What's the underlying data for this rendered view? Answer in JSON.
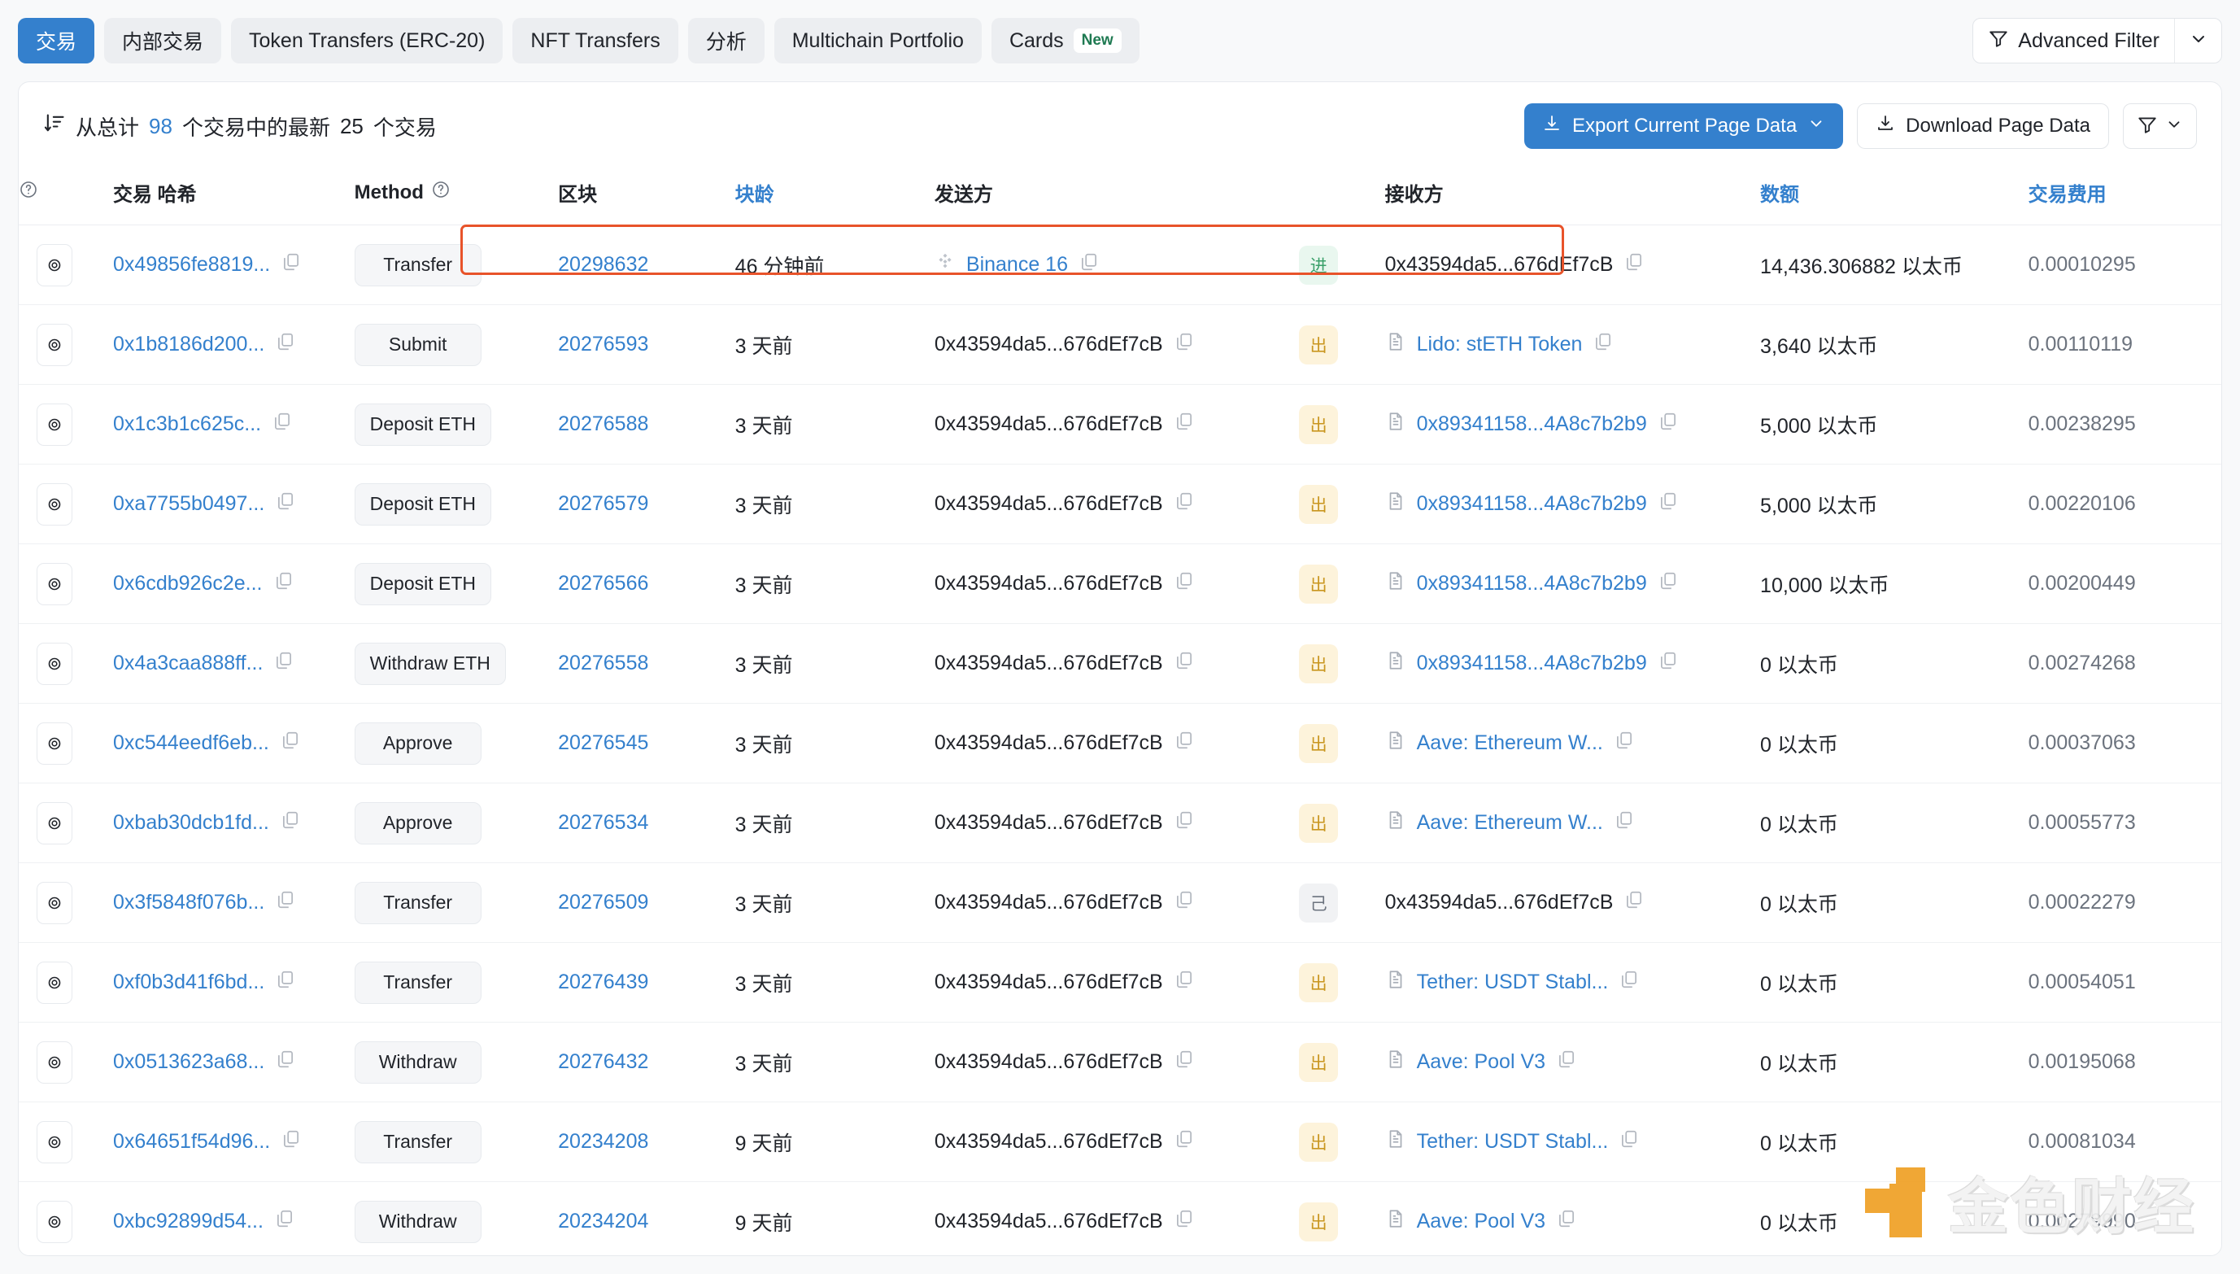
{
  "topbar": {
    "tabs": [
      {
        "label": "交易",
        "active": true
      },
      {
        "label": "内部交易",
        "active": false
      },
      {
        "label": "Token Transfers (ERC-20)",
        "active": false
      },
      {
        "label": "NFT Transfers",
        "active": false
      },
      {
        "label": "分析",
        "active": false
      },
      {
        "label": "Multichain Portfolio",
        "active": false
      },
      {
        "label": "Cards",
        "active": false,
        "badge": "New"
      }
    ],
    "advanced_filter_label": "Advanced Filter"
  },
  "card_head": {
    "summary_prefix": "从总计",
    "total_count": "98",
    "summary_middle": "个交易中的最新",
    "page_count": "25",
    "summary_suffix": "个交易",
    "export_label": "Export Current Page Data",
    "download_label": "Download Page Data"
  },
  "table": {
    "columns": [
      {
        "key": "eye",
        "label": "",
        "link": false
      },
      {
        "key": "hash",
        "label": "交易 哈希",
        "link": false
      },
      {
        "key": "method",
        "label": "Method",
        "link": false
      },
      {
        "key": "block",
        "label": "区块",
        "link": false
      },
      {
        "key": "age",
        "label": "块龄",
        "link": true
      },
      {
        "key": "from",
        "label": "发送方",
        "link": false
      },
      {
        "key": "dir",
        "label": "",
        "link": false
      },
      {
        "key": "to",
        "label": "接收方",
        "link": false
      },
      {
        "key": "amount",
        "label": "数额",
        "link": true
      },
      {
        "key": "fee",
        "label": "交易费用",
        "link": true
      }
    ],
    "rows": [
      {
        "hash": "0x49856fe8819...",
        "method": "Transfer",
        "block": "20298632",
        "age": "46 分钟前",
        "from": "Binance 16",
        "from_link": true,
        "from_icon": "binance-icon",
        "dir": "进",
        "dir_type": "in",
        "to": "0x43594da5...676dEf7cB",
        "to_link": false,
        "to_contract": false,
        "amount": "14,436.306882 以太币",
        "fee": "0.00010295",
        "highlight": true
      },
      {
        "hash": "0x1b8186d200...",
        "method": "Submit",
        "block": "20276593",
        "age": "3 天前",
        "from": "0x43594da5...676dEf7cB",
        "from_link": false,
        "from_icon": "",
        "dir": "出",
        "dir_type": "out",
        "to": "Lido: stETH Token",
        "to_link": true,
        "to_contract": true,
        "amount": "3,640 以太币",
        "fee": "0.00110119",
        "highlight": false
      },
      {
        "hash": "0x1c3b1c625c...",
        "method": "Deposit ETH",
        "block": "20276588",
        "age": "3 天前",
        "from": "0x43594da5...676dEf7cB",
        "from_link": false,
        "from_icon": "",
        "dir": "出",
        "dir_type": "out",
        "to": "0x89341158...4A8c7b2b9",
        "to_link": true,
        "to_contract": true,
        "amount": "5,000 以太币",
        "fee": "0.00238295",
        "highlight": false
      },
      {
        "hash": "0xa7755b0497...",
        "method": "Deposit ETH",
        "block": "20276579",
        "age": "3 天前",
        "from": "0x43594da5...676dEf7cB",
        "from_link": false,
        "from_icon": "",
        "dir": "出",
        "dir_type": "out",
        "to": "0x89341158...4A8c7b2b9",
        "to_link": true,
        "to_contract": true,
        "amount": "5,000 以太币",
        "fee": "0.00220106",
        "highlight": false
      },
      {
        "hash": "0x6cdb926c2e...",
        "method": "Deposit ETH",
        "block": "20276566",
        "age": "3 天前",
        "from": "0x43594da5...676dEf7cB",
        "from_link": false,
        "from_icon": "",
        "dir": "出",
        "dir_type": "out",
        "to": "0x89341158...4A8c7b2b9",
        "to_link": true,
        "to_contract": true,
        "amount": "10,000 以太币",
        "fee": "0.00200449",
        "highlight": false
      },
      {
        "hash": "0x4a3caa888ff...",
        "method": "Withdraw ETH",
        "block": "20276558",
        "age": "3 天前",
        "from": "0x43594da5...676dEf7cB",
        "from_link": false,
        "from_icon": "",
        "dir": "出",
        "dir_type": "out",
        "to": "0x89341158...4A8c7b2b9",
        "to_link": true,
        "to_contract": true,
        "amount": "0 以太币",
        "fee": "0.00274268",
        "highlight": false
      },
      {
        "hash": "0xc544eedf6eb...",
        "method": "Approve",
        "block": "20276545",
        "age": "3 天前",
        "from": "0x43594da5...676dEf7cB",
        "from_link": false,
        "from_icon": "",
        "dir": "出",
        "dir_type": "out",
        "to": "Aave: Ethereum W...",
        "to_link": true,
        "to_contract": true,
        "amount": "0 以太币",
        "fee": "0.00037063",
        "highlight": false
      },
      {
        "hash": "0xbab30dcb1fd...",
        "method": "Approve",
        "block": "20276534",
        "age": "3 天前",
        "from": "0x43594da5...676dEf7cB",
        "from_link": false,
        "from_icon": "",
        "dir": "出",
        "dir_type": "out",
        "to": "Aave: Ethereum W...",
        "to_link": true,
        "to_contract": true,
        "amount": "0 以太币",
        "fee": "0.00055773",
        "highlight": false
      },
      {
        "hash": "0x3f5848f076b...",
        "method": "Transfer",
        "block": "20276509",
        "age": "3 天前",
        "from": "0x43594da5...676dEf7cB",
        "from_link": false,
        "from_icon": "",
        "dir": "己",
        "dir_type": "self",
        "to": "0x43594da5...676dEf7cB",
        "to_link": false,
        "to_contract": false,
        "amount": "0 以太币",
        "fee": "0.00022279",
        "highlight": false
      },
      {
        "hash": "0xf0b3d41f6bd...",
        "method": "Transfer",
        "block": "20276439",
        "age": "3 天前",
        "from": "0x43594da5...676dEf7cB",
        "from_link": false,
        "from_icon": "",
        "dir": "出",
        "dir_type": "out",
        "to": "Tether: USDT Stabl...",
        "to_link": true,
        "to_contract": true,
        "amount": "0 以太币",
        "fee": "0.00054051",
        "highlight": false
      },
      {
        "hash": "0x0513623a68...",
        "method": "Withdraw",
        "block": "20276432",
        "age": "3 天前",
        "from": "0x43594da5...676dEf7cB",
        "from_link": false,
        "from_icon": "",
        "dir": "出",
        "dir_type": "out",
        "to": "Aave: Pool V3",
        "to_link": true,
        "to_contract": true,
        "amount": "0 以太币",
        "fee": "0.00195068",
        "highlight": false
      },
      {
        "hash": "0x64651f54d96...",
        "method": "Transfer",
        "block": "20234208",
        "age": "9 天前",
        "from": "0x43594da5...676dEf7cB",
        "from_link": false,
        "from_icon": "",
        "dir": "出",
        "dir_type": "out",
        "to": "Tether: USDT Stabl...",
        "to_link": true,
        "to_contract": true,
        "amount": "0 以太币",
        "fee": "0.00081034",
        "highlight": false
      },
      {
        "hash": "0xbc92899d54...",
        "method": "Withdraw",
        "block": "20234204",
        "age": "9 天前",
        "from": "0x43594da5...676dEf7cB",
        "from_link": false,
        "from_icon": "",
        "dir": "出",
        "dir_type": "out",
        "to": "Aave: Pool V3",
        "to_link": true,
        "to_contract": true,
        "amount": "0 以太币",
        "fee": "0.00279990",
        "highlight": false
      }
    ]
  },
  "watermark": {
    "text": "金色财经"
  },
  "colors": {
    "accent_blue": "#3480cd",
    "highlight_red": "#e8532a",
    "in_green": "#3aa06a",
    "out_yellow": "#c9961f",
    "watermark_orange": "#efa024"
  }
}
